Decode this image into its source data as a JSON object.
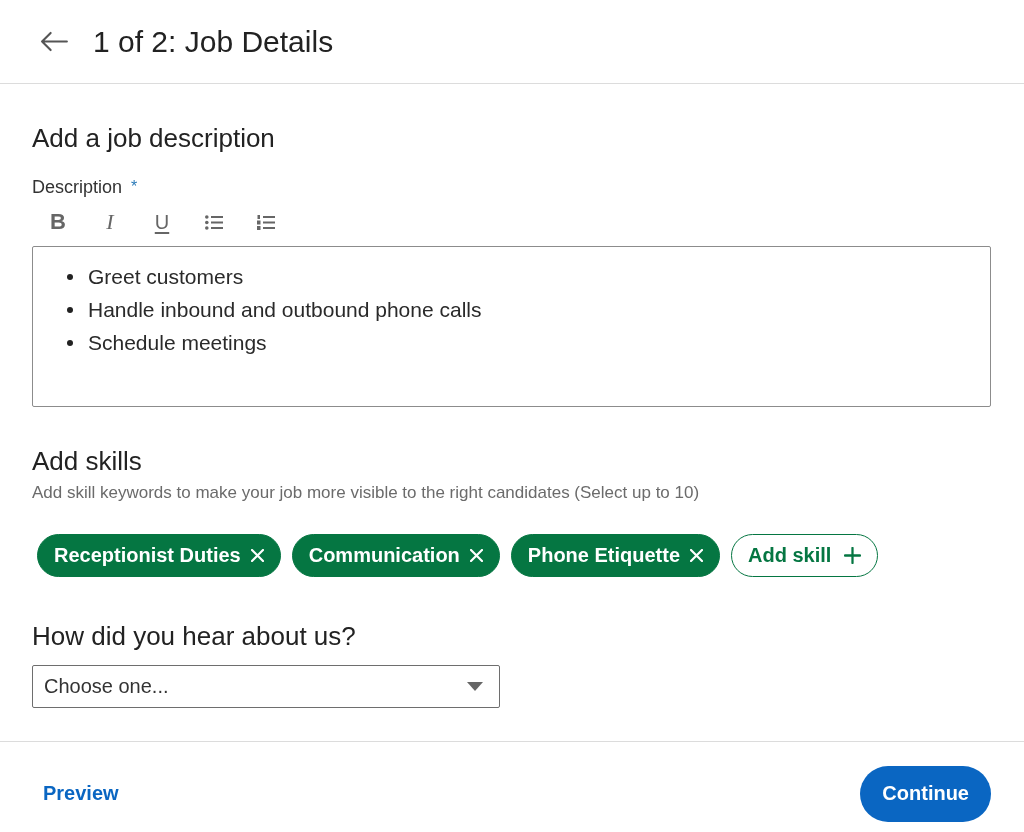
{
  "header": {
    "title": "1 of 2: Job Details"
  },
  "job_description": {
    "heading": "Add a job description",
    "field_label": "Description",
    "required_mark": "*",
    "toolbar": [
      {
        "kind": "bold",
        "label": "B"
      },
      {
        "kind": "italic",
        "label": "I"
      },
      {
        "kind": "underline",
        "label": "U"
      },
      {
        "kind": "bulleted_list"
      },
      {
        "kind": "numbered_list"
      }
    ],
    "items": [
      "Greet customers",
      "Handle inbound and outbound phone calls",
      "Schedule meetings"
    ]
  },
  "skills": {
    "heading": "Add skills",
    "hint": "Add skill keywords to make your job more visible to the right candidates (Select up to 10)",
    "chips": [
      "Receptionist Duties",
      "Communication",
      "Phone Etiquette"
    ],
    "add_button": "Add skill"
  },
  "referral": {
    "question": "How did you hear about us?",
    "select": {
      "placeholder": "Choose one..."
    }
  },
  "footer": {
    "preview_link": "Preview",
    "continue_button": "Continue"
  }
}
